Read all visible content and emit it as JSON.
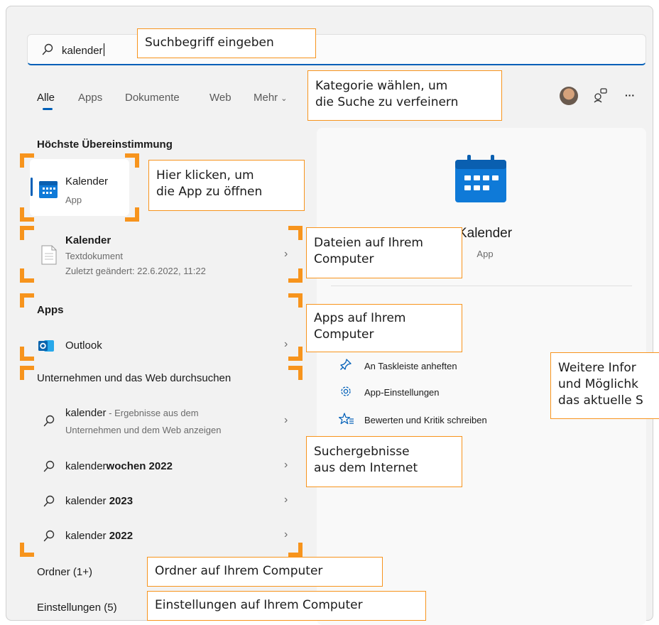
{
  "search": {
    "value": "kalender"
  },
  "tabs": [
    {
      "label": "Alle"
    },
    {
      "label": "Apps"
    },
    {
      "label": "Dokumente"
    },
    {
      "label": "Web"
    },
    {
      "label": "Mehr"
    }
  ],
  "toolbar": {
    "more_label": "···"
  },
  "left": {
    "best_match_heading": "Höchste Übereinstimmung",
    "best_match": {
      "title": "Kalender",
      "subtitle": "App"
    },
    "document": {
      "title": "Kalender",
      "type": "Textdokument",
      "modified": "Zuletzt geändert: 22.6.2022, 11:22"
    },
    "apps_heading": "Apps",
    "outlook_label": "Outlook",
    "web_heading": "Unternehmen und das Web durchsuchen",
    "web_results": [
      {
        "bold": "kalender",
        "normal": " - Ergebnisse aus dem",
        "line2": "Unternehmen und dem Web anzeigen"
      },
      {
        "normal": "kalender",
        "bold": "wochen 2022"
      },
      {
        "normal": "kalender ",
        "bold": "2023"
      },
      {
        "normal": "kalender ",
        "bold": "2022"
      }
    ],
    "folders_heading": "Ordner (1+)",
    "settings_heading": "Einstellungen (5)"
  },
  "right": {
    "app_name": "Kalender",
    "app_type": "App",
    "actions": [
      {
        "label": "An Taskleiste anheften",
        "icon": "pin-icon"
      },
      {
        "label": "App-Einstellungen",
        "icon": "gear-icon"
      },
      {
        "label": "Bewerten und Kritik schreiben",
        "icon": "star-list-icon"
      }
    ]
  },
  "callouts": {
    "search": "Suchbegriff eingeben",
    "category": "Kategorie wählen, um\ndie Suche zu verfeinern",
    "open_app": "Hier klicken, um\ndie App zu öffnen",
    "files": "Dateien auf Ihrem\nComputer",
    "apps": "Apps auf Ihrem\nComputer",
    "more_info": "Weitere Infor\nund Möglichk\ndas aktuelle S",
    "web": "Suchergebnisse\naus dem Internet",
    "folders": "Ordner auf Ihrem Computer",
    "settings": "Einstellungen auf Ihrem Computer"
  },
  "colors": {
    "accent": "#005fb8",
    "callout": "#f7941d",
    "calendar_blue": "#0f7ad8"
  }
}
